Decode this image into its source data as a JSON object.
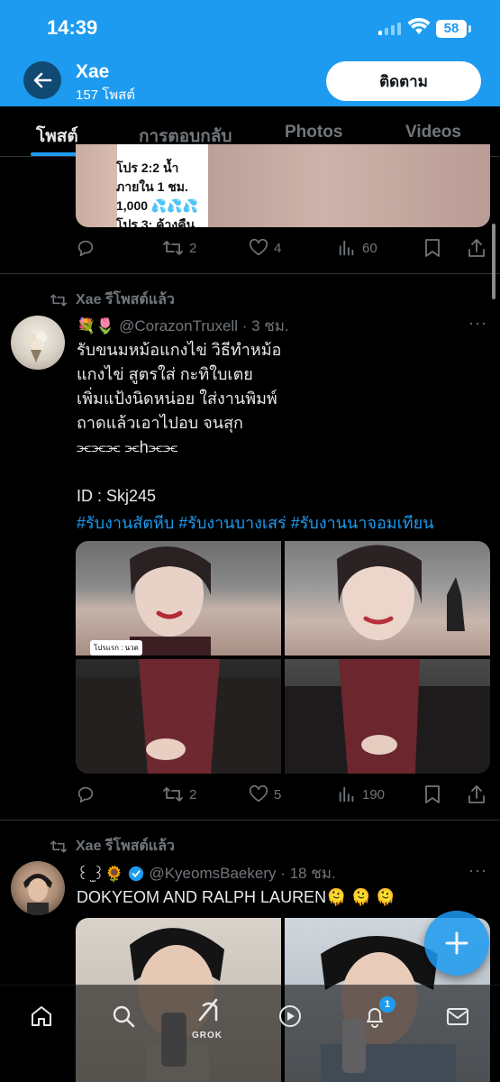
{
  "status_bar": {
    "time": "14:39",
    "battery": "58"
  },
  "header": {
    "name": "Xae",
    "post_count": "157 โพสต์",
    "follow_label": "ติดตาม"
  },
  "tabs": [
    {
      "label": "โพสต์",
      "active": true
    },
    {
      "label": "การตอบกลับ",
      "active": false
    },
    {
      "label": "Photos",
      "active": false
    },
    {
      "label": "Videos",
      "active": false
    }
  ],
  "post1": {
    "image_text": "โปร 2:2 น้ำ\nภายใน 1 ชม.\n1,000 💦💦💦\nโปร 3: ค้างคืน",
    "replies": "",
    "reposts": "2",
    "likes": "4",
    "views": "60"
  },
  "post2": {
    "repost_label": "Xae รีโพสต์แล้ว",
    "display_name": "💐🌷",
    "handle_time": "@CorazonTruxell · 3 ชม.",
    "text": "รับขนมหม้อแกงไข่ วิธีทำหม้อ\nแกงไข่ สูตรใส่ กะทิใบเตย\nเพิ่มแป้งนิดหน่อย ใส่งานพิมพ์\nถาดแล้วเอาไปอบ จนสุก\n⫘⫘⫘         ⫘h⫘⫘\n\nID : Skj245",
    "hashtags": "#รับงานสัตหีบ #รับงานบางเสร่ #รับงานนาจอมเทียน",
    "photo_sticker": "โปรแรก : นวด",
    "replies": "",
    "reposts": "2",
    "likes": "5",
    "views": "190"
  },
  "post3": {
    "repost_label": "Xae รีโพสต์แล้ว",
    "display_name": "꒰ ̫꒱🌻",
    "handle_time": "@KyeomsBaekery · 18 ชม.",
    "text": "DOKYEOM AND RALPH LAUREN🫠 🫠 🫠"
  },
  "bottom_nav": {
    "grok_label": "GROK",
    "notifications_badge": "1"
  },
  "colors": {
    "accent": "#1d9bf0",
    "background": "#000000",
    "muted": "#71767b",
    "text": "#e7e9ea"
  }
}
